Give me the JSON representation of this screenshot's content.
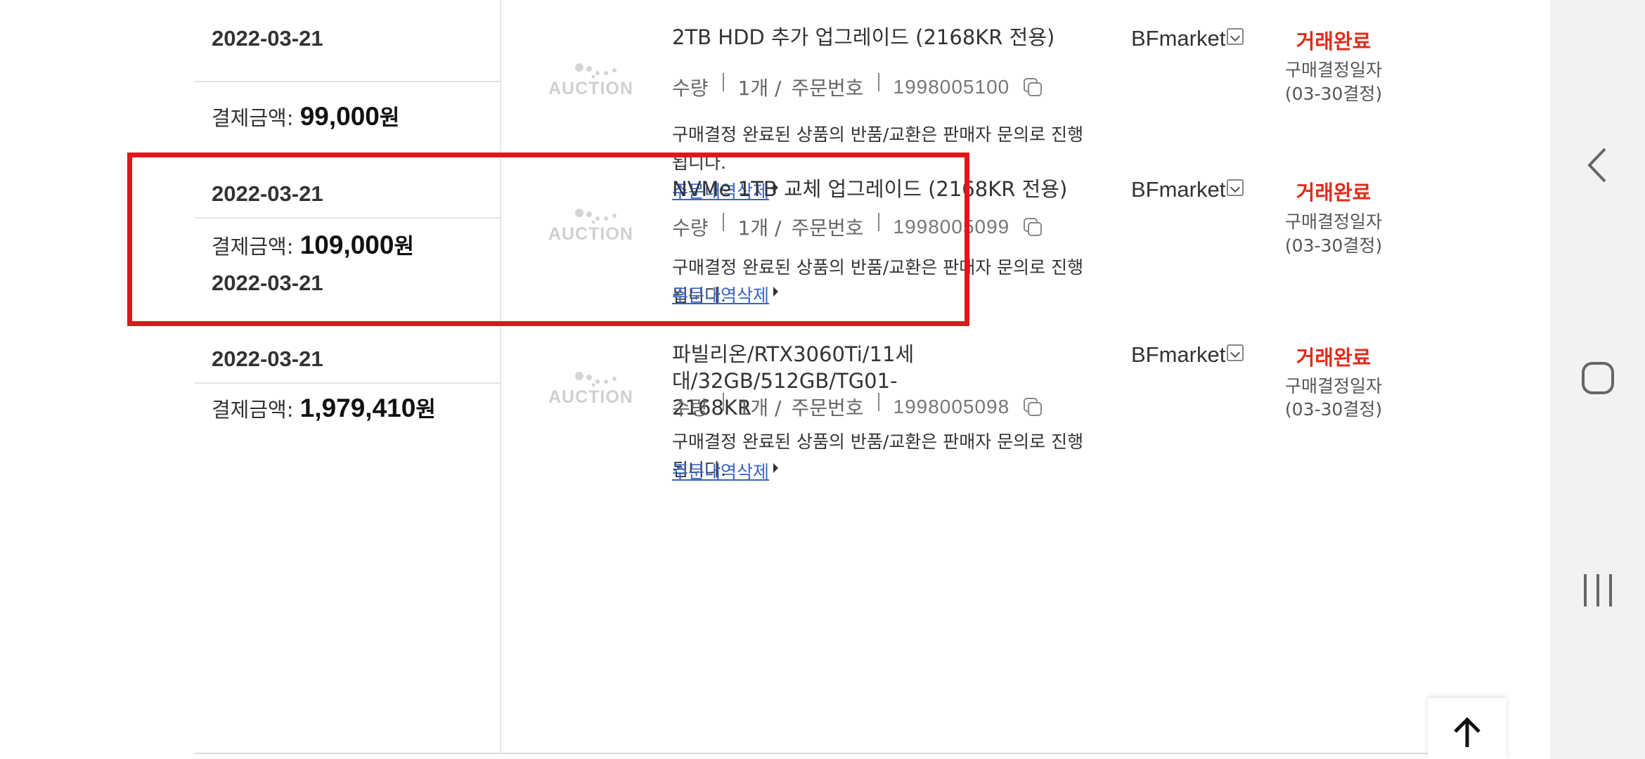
{
  "orders": [
    {
      "date": "2022-03-21",
      "pay_label": "결제금액: ",
      "pay_amount": "99,000",
      "pay_unit": "원",
      "logo_text": "AUCTION",
      "product_name": "2TB HDD 추가 업그레이드 (2168KR 전용)",
      "qty_label": "수량",
      "qty_value": "1개 /",
      "order_no_label": "주문번호",
      "order_no": "1998005100",
      "notice": "구매결정 완료된 상품의 반품/교환은 판매자 문의로 진행됩니다.",
      "delete_link": "주문내역삭제",
      "seller": "BFmarket",
      "status": "거래완료",
      "status_sub1": "구매결정일자",
      "status_sub2": "(03-30결정)"
    },
    {
      "date": "2022-03-21",
      "pay_label": "결제금액: ",
      "pay_amount": "109,000",
      "pay_unit": "원",
      "logo_text": "AUCTION",
      "product_name": "NVMe 1TB 교체 업그레이드 (2168KR 전용)",
      "qty_label": "수량",
      "qty_value": "1개 /",
      "order_no_label": "주문번호",
      "order_no": "1998005099",
      "notice": "구매결정 완료된 상품의 반품/교환은 판매자 문의로 진행됩니다.",
      "delete_link": "주문내역삭제",
      "seller": "BFmarket",
      "status": "거래완료",
      "status_sub1": "구매결정일자",
      "status_sub2": "(03-30결정)"
    },
    {
      "date": "2022-03-21",
      "pay_label": "결제금액: ",
      "pay_amount": "1,979,410",
      "pay_unit": "원",
      "logo_text": "AUCTION",
      "product_name": "파빌리온/RTX3060Ti/11세대/32GB/512GB/TG01-2168KR",
      "qty_label": "수량",
      "qty_value": "1개 /",
      "order_no_label": "주문번호",
      "order_no": "1998005098",
      "notice": "구매결정 완료된 상품의 반품/교환은 판매자 문의로 진행됩니다.",
      "delete_link": "주문내역삭제",
      "seller": "BFmarket",
      "status": "거래완료",
      "status_sub1": "구매결정일자",
      "status_sub2": "(03-30결정)"
    }
  ],
  "colors": {
    "status": "#e02c1b",
    "link": "#3a63c4",
    "highlight_border": "#e0161a",
    "nav_bg": "#f2f2f2"
  },
  "icons": {
    "scroll_top": "arrow-up-icon",
    "copy": "copy-icon",
    "seller_dropdown": "chevron-down-icon",
    "nav_back": "back-icon",
    "nav_home": "home-icon",
    "nav_recents": "recents-icon"
  }
}
